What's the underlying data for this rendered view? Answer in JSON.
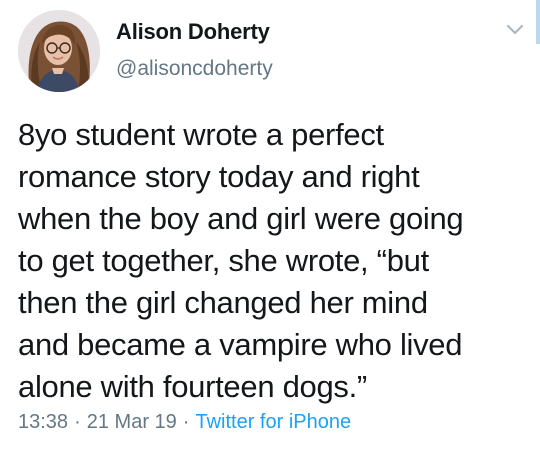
{
  "author": {
    "display_name": "Alison Doherty",
    "handle": "@alisoncdoherty"
  },
  "tweet": {
    "text": "8yo student wrote a perfect\nromance story today and right\nwhen the boy and girl were going\nto get together, she wrote, “but\nthen the girl changed her mind\nand became a vampire who lived\nalone with fourteen dogs.”"
  },
  "meta": {
    "time": "13:38",
    "separator": "·",
    "date": "21 Mar 19",
    "source": "Twitter for iPhone"
  },
  "icons": {
    "menu": "chevron-down-icon"
  },
  "colors": {
    "text": "#14171a",
    "secondary": "#657786",
    "link": "#1da1f2"
  }
}
